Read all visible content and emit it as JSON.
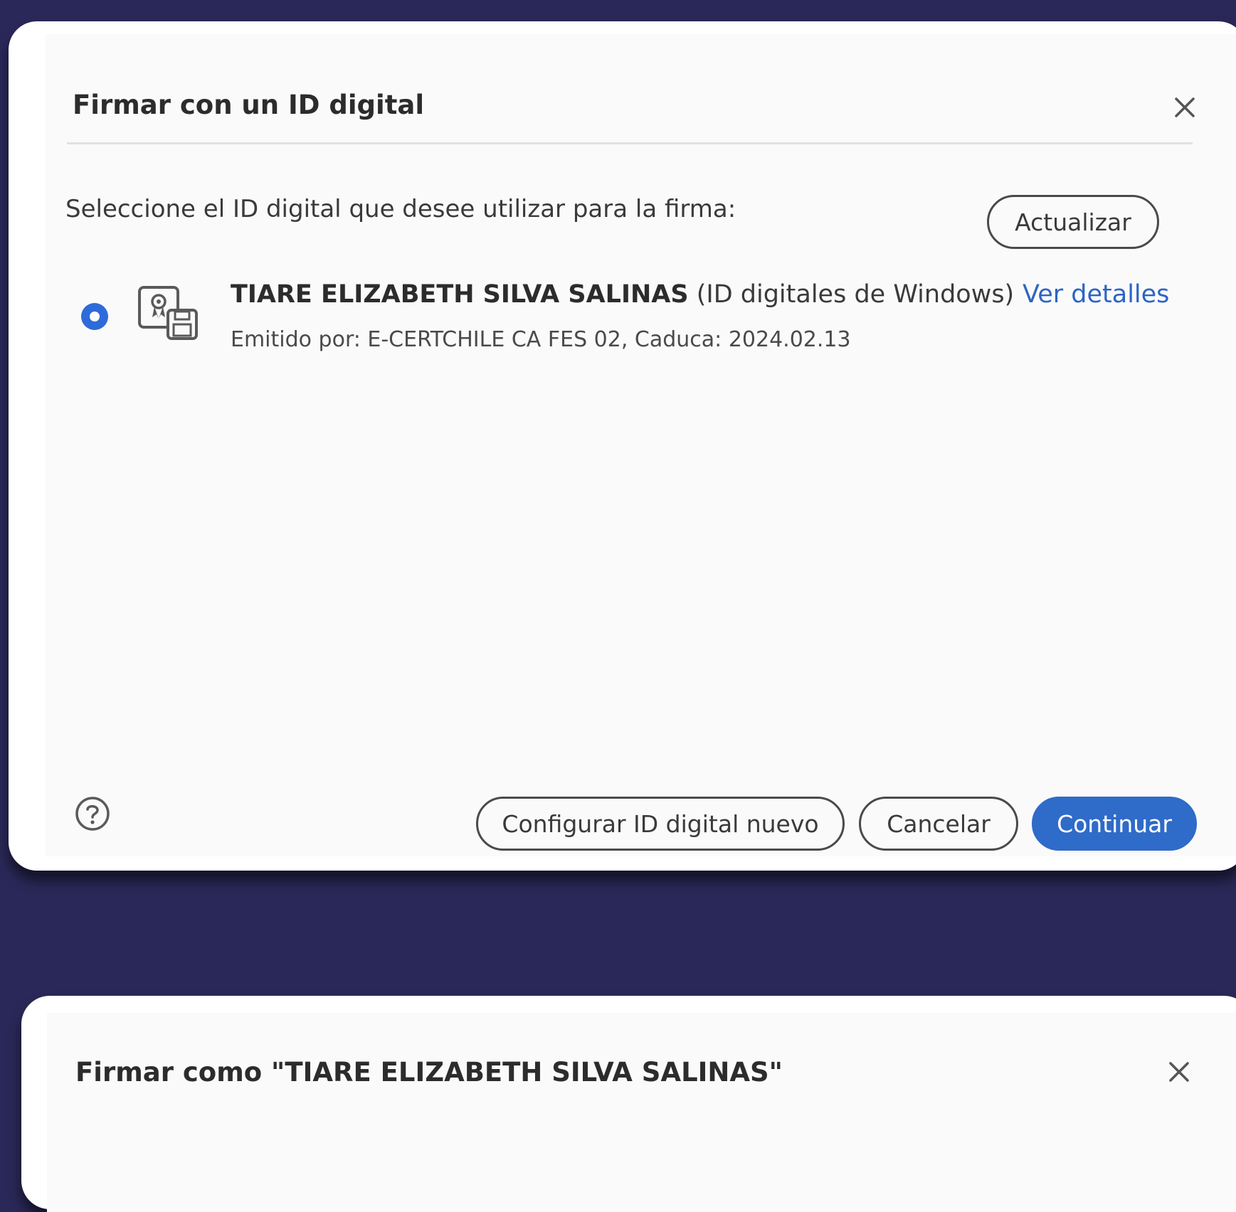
{
  "dialog_select": {
    "title": "Firmar con un ID digital",
    "prompt": "Seleccione el ID digital que desee utilizar para la firma:",
    "refresh_label": "Actualizar",
    "certificate": {
      "selected": true,
      "name": "TIARE ELIZABETH SILVA SALINAS",
      "store": "(ID digitales de Windows)",
      "issuer": "Emitido por: E-CERTCHILE CA FES 02, Caduca: 2024.02.13",
      "details_label": "Ver detalles",
      "icon": "certificate-icon"
    },
    "buttons": {
      "configure_label": "Configurar ID digital nuevo",
      "cancel_label": "Cancelar",
      "continue_label": "Continuar"
    },
    "icons": {
      "close": "close-icon",
      "help": "help-icon"
    }
  },
  "dialog_sign_as": {
    "title": "Firmar como \"TIARE ELIZABETH SILVA SALINAS\""
  },
  "colors": {
    "background": "#2a2858",
    "accent": "#2f6bc8",
    "link": "#2c64c4"
  }
}
